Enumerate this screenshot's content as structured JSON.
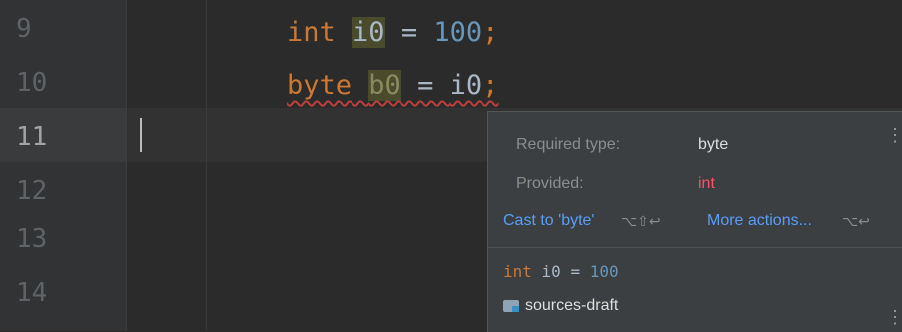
{
  "editor": {
    "line_numbers": [
      "9",
      "10",
      "11",
      "12",
      "13",
      "14"
    ],
    "line9": {
      "kw": "int",
      "var": "i0",
      "eq": " = ",
      "num": "100",
      "end": ";"
    },
    "line10": {
      "kw": "byte",
      "var": "b0",
      "eq": " = ",
      "rhs": "i0",
      "end": ";"
    }
  },
  "popup": {
    "required_label": "Required type:",
    "required_value": "byte",
    "provided_label": "Provided:",
    "provided_value": "int",
    "cast_action": "Cast to 'byte'",
    "cast_shortcut": "⌥⇧↩",
    "more_actions": "More actions...",
    "more_shortcut": "⌥↩",
    "preview": {
      "kw": "int",
      "rest": " i0 = ",
      "num": "100"
    },
    "folder_name": "sources-draft"
  },
  "colors": {
    "background": "#2b2b2b",
    "keyword": "#cc7832",
    "number": "#6897bb",
    "link": "#589df6",
    "error": "#f75464"
  },
  "icons": [
    "folder-icon",
    "more-options-icon"
  ]
}
